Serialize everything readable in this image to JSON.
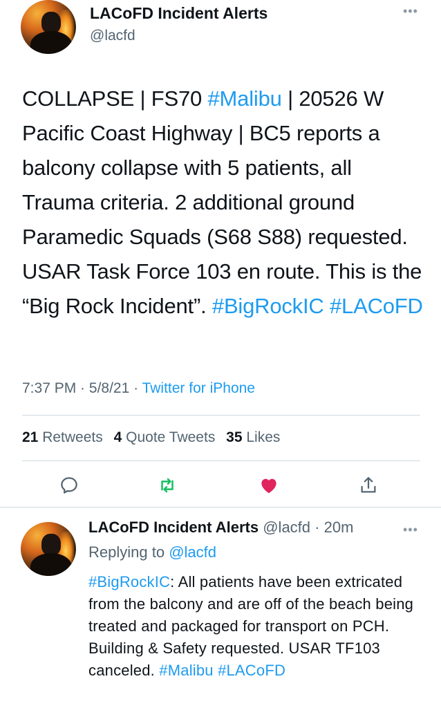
{
  "tweet": {
    "author_name": "LACoFD Incident Alerts",
    "handle": "@lacfd",
    "more_icon": "…",
    "body": {
      "t1": "COLLAPSE | FS70 ",
      "tag1": "#Malibu",
      "t2": " | 20526 W Pacific Coast Highway | BC5 reports a balcony collapse with 5 patients, all Trauma criteria. 2 additional ground Paramedic Squads (S68 S88) requested. USAR Task Force 103 en route. This is the “Big Rock Incident”. ",
      "tag2": "#BigRockIC",
      "tag3": "#LACoFD"
    },
    "time": "7:37 PM",
    "date": "5/8/21",
    "source": "Twitter for iPhone",
    "stats": {
      "retweets_count": "21",
      "retweets_label": "Retweets",
      "quotes_count": "4",
      "quotes_label": "Quote Tweets",
      "likes_count": "35",
      "likes_label": "Likes"
    },
    "actions": {
      "reply_icon": "reply-icon",
      "retweet_icon": "retweet-icon",
      "like_icon": "heart-icon",
      "share_icon": "share-icon",
      "accent_retweet": "#17bf63",
      "accent_like": "#e0245e",
      "accent_gray": "#536471"
    }
  },
  "reply": {
    "author_name": "LACoFD Incident Alerts",
    "handle": "@lacfd",
    "time_ago": "20m",
    "more_icon": "…",
    "replying_label": "Replying to",
    "replying_to": "@lacfd",
    "body": {
      "tag1": "#BigRockIC",
      "text": ": All patients have been extricated from the balcony and are off of the beach being treated and packaged for transport on PCH. Building & Safety requested. USAR TF103 canceled. ",
      "tag2": "#Malibu",
      "tag3": "#LACoFD"
    }
  },
  "colors": {
    "link": "#1d9bf0",
    "text": "#0f1419",
    "secondary": "#536471"
  }
}
